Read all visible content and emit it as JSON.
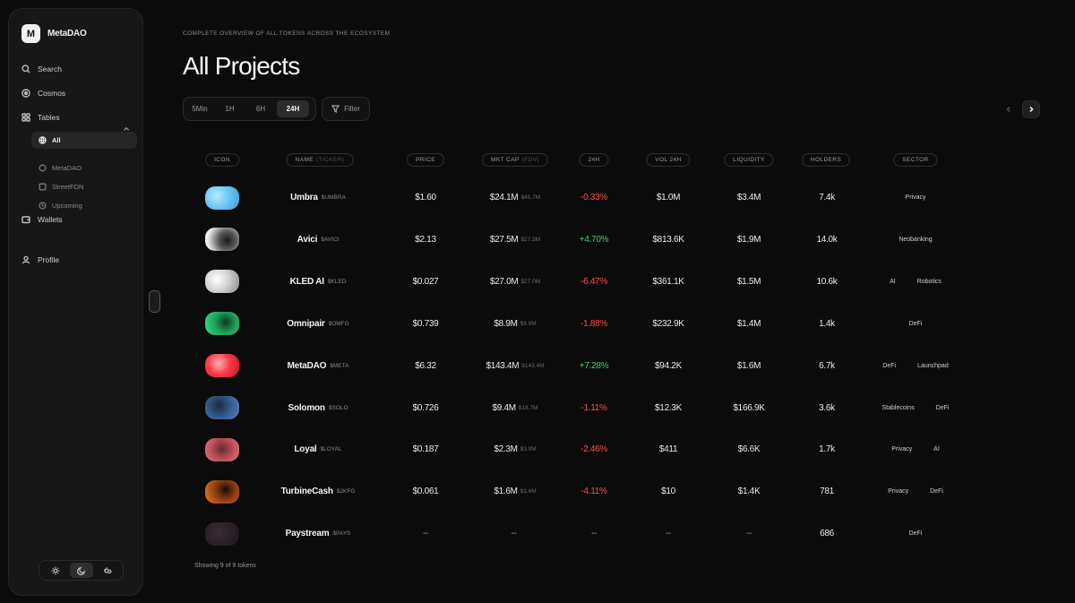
{
  "brand": {
    "logo": "M",
    "name": "MetaDAO"
  },
  "nav": [
    {
      "label": "Search",
      "icon": "search-icon"
    },
    {
      "label": "Cosmos",
      "icon": "target-icon"
    },
    {
      "label": "Tables",
      "icon": "grid-icon"
    },
    {
      "label": "Wallets",
      "icon": "wallet-icon"
    },
    {
      "label": "Profile",
      "icon": "user-icon"
    }
  ],
  "tables_sub": [
    {
      "label": "All",
      "icon": "globe-icon",
      "active": true
    },
    {
      "label": "MetaDAO",
      "icon": "circle-icon"
    },
    {
      "label": "StreetFDN",
      "icon": "square-icon"
    },
    {
      "label": "Upcoming",
      "icon": "clock-icon"
    }
  ],
  "header": {
    "eyebrow": "COMPLETE OVERVIEW OF ALL TOKENS ACROSS THE ECOSYSTEM",
    "title": "All Projects"
  },
  "time_filters": [
    "5Min",
    "1H",
    "6H",
    "24H"
  ],
  "active_time": "24H",
  "filter_label": "Filter",
  "columns": {
    "icon": "ICON",
    "name": "NAME",
    "name_muted": "(TICKER)",
    "price": "PRICE",
    "mktcap": "MKT CAP",
    "mktcap_muted": "(FDV)",
    "change": "24H",
    "vol": "VOL 24H",
    "liquidity": "LIQUIDITY",
    "holders": "HOLDERS",
    "sector": "SECTOR"
  },
  "rows": [
    {
      "name": "Umbra",
      "ticker": "$UMBRA",
      "price": "$1.60",
      "mktcap": "$24.1M",
      "fdv": "$45.7M",
      "change": "-0.33%",
      "dir": "neg",
      "vol": "$1.0M",
      "liquidity": "$3.4M",
      "holders": "7.4k",
      "sectors": [
        "Privacy"
      ],
      "gradient": "radial-gradient(circle at 35% 40%, #b9ecff 0%, #6cc8f5 45%, #3a9bd8 100%)"
    },
    {
      "name": "Avici",
      "ticker": "$AVICI",
      "price": "$2.13",
      "mktcap": "$27.5M",
      "fdv": "$27.5M",
      "change": "+4.70%",
      "dir": "pos",
      "vol": "$813.6K",
      "liquidity": "$1.9M",
      "holders": "14.0k",
      "sectors": [
        "Neobanking"
      ],
      "gradient": "radial-gradient(circle at 65% 55%, #1a1a1a 0%, #5a5a5a 35%, #e8e8e8 75%, #ffffff 100%)"
    },
    {
      "name": "KLED AI",
      "ticker": "$KLED",
      "price": "$0.027",
      "mktcap": "$27.0M",
      "fdv": "$27.0M",
      "change": "-6.47%",
      "dir": "neg",
      "vol": "$361.1K",
      "liquidity": "$1.5M",
      "holders": "10.6k",
      "sectors": [
        "AI",
        "Robotics"
      ],
      "gradient": "radial-gradient(circle at 35% 40%, #ffffff 0%, #d8d8d8 40%, #8a8a8a 100%)"
    },
    {
      "name": "Omnipair",
      "ticker": "$OMFG",
      "price": "$0.739",
      "mktcap": "$8.9M",
      "fdv": "$8.9M",
      "change": "-1.88%",
      "dir": "neg",
      "vol": "$232.9K",
      "liquidity": "$1.4M",
      "holders": "1.4k",
      "sectors": [
        "DeFi"
      ],
      "gradient": "radial-gradient(circle at 60% 45%, #0b3a22 0%, #1fa25a 45%, #3ee08a 100%)"
    },
    {
      "name": "MetaDAO",
      "ticker": "$META",
      "price": "$6.32",
      "mktcap": "$143.4M",
      "fdv": "$143.4M",
      "change": "+7.28%",
      "dir": "pos",
      "vol": "$94.2K",
      "liquidity": "$1.6M",
      "holders": "6.7k",
      "sectors": [
        "DeFi",
        "Launchpad"
      ],
      "gradient": "radial-gradient(circle at 40% 40%, #ffb3b3 0%, #ff3b4a 45%, #b8122a 100%)"
    },
    {
      "name": "Solomon",
      "ticker": "$SOLO",
      "price": "$0.726",
      "mktcap": "$9.4M",
      "fdv": "$18.7M",
      "change": "-1.11%",
      "dir": "neg",
      "vol": "$12.3K",
      "liquidity": "$166.9K",
      "holders": "3.6k",
      "sectors": [
        "Stablecoins",
        "DeFi"
      ],
      "gradient": "radial-gradient(circle at 40% 40%, #1c2a44 0%, #355b8f 50%, #5b86c4 100%)"
    },
    {
      "name": "Loyal",
      "ticker": "$LOYAL",
      "price": "$0.187",
      "mktcap": "$2.3M",
      "fdv": "$3.9M",
      "change": "-2.46%",
      "dir": "neg",
      "vol": "$411",
      "liquidity": "$6.6K",
      "holders": "1.7k",
      "sectors": [
        "Privacy",
        "AI"
      ],
      "gradient": "radial-gradient(circle at 50% 45%, #6a2a30 0%, #c0525a 55%, #e07a80 100%)"
    },
    {
      "name": "TurbineCash",
      "ticker": "$2KFG",
      "price": "$0.061",
      "mktcap": "$1.6M",
      "fdv": "$1.6M",
      "change": "-4.11%",
      "dir": "neg",
      "vol": "$10",
      "liquidity": "$1.4K",
      "holders": "781",
      "sectors": [
        "Privacy",
        "DeFi"
      ],
      "gradient": "radial-gradient(circle at 60% 40%, #1a0d05 0%, #7a3510 35%, #ff7a1a 100%)"
    },
    {
      "name": "Paystream",
      "ticker": "$PAYS",
      "price": "--",
      "mktcap": "--",
      "fdv": "",
      "change": "--",
      "dir": "dash",
      "vol": "--",
      "liquidity": "--",
      "holders": "686",
      "sectors": [
        "DeFi"
      ],
      "gradient": "radial-gradient(circle at 40% 40%, #3a2a33 0%, #2a1f26 60%, #1a1418 100%)"
    }
  ],
  "footer": "Showing 9 of 9 tokens",
  "theme_buttons": [
    "sun-icon",
    "moon-icon",
    "auto-theme-icon"
  ],
  "active_theme": "moon-icon",
  "colors": {
    "positive": "#3ecf6a",
    "negative": "#ff4d4d",
    "background": "#0b0b0b",
    "sidebar": "#171717"
  }
}
